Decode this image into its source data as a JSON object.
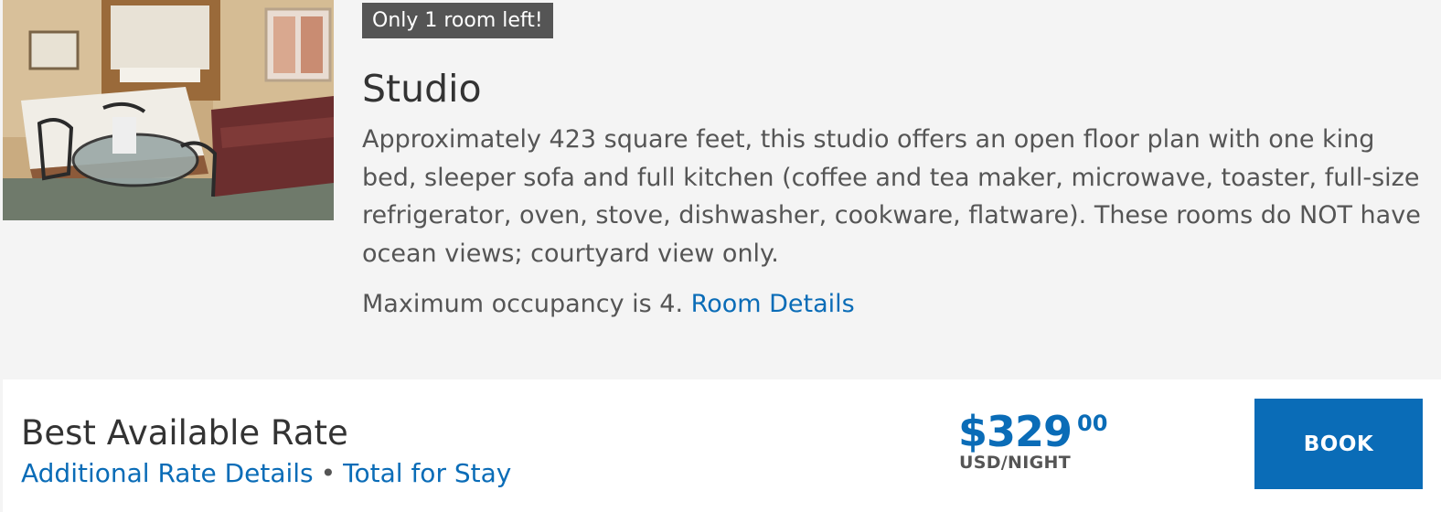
{
  "room": {
    "badge": "Only 1 room left!",
    "title": "Studio",
    "description": "Approximately 423 square feet, this studio offers an open floor plan with one king bed, sleeper sofa and full kitchen (coffee and tea maker, microwave, toaster, full-size refrigerator, oven, stove, dishwasher, cookware, flatware). These rooms do NOT have ocean views; courtyard view only.",
    "occupancy": "Maximum occupancy is 4.",
    "details_link": "Room Details"
  },
  "rate": {
    "name": "Best Available Rate",
    "additional_link": "Additional Rate Details",
    "separator": "•",
    "total_link": "Total for Stay",
    "price_whole": "$329",
    "price_cents": "00",
    "price_unit": "USD/NIGHT",
    "book_label": "BOOK"
  },
  "colors": {
    "accent": "#0a6cb7",
    "badge_bg": "#555555",
    "page_bg": "#f4f4f4",
    "rate_bg": "#ffffff"
  }
}
